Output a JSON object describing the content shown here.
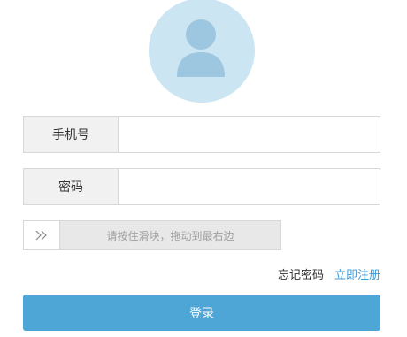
{
  "avatar": {
    "icon": "user-icon",
    "background_color": "#cbe5f2",
    "icon_color": "#9dc7e0"
  },
  "form": {
    "phone": {
      "label": "手机号",
      "value": "",
      "placeholder": ""
    },
    "password": {
      "label": "密码",
      "value": "",
      "placeholder": ""
    }
  },
  "slider": {
    "handle_icon": "double-chevron-right-icon",
    "text": "请按住滑块，拖动到最右边"
  },
  "links": {
    "forgot_password": "忘记密码",
    "register": "立即注册"
  },
  "login_button": {
    "label": "登录",
    "color": "#4ea6d6"
  },
  "colors": {
    "link_accent": "#3f9bd6"
  }
}
